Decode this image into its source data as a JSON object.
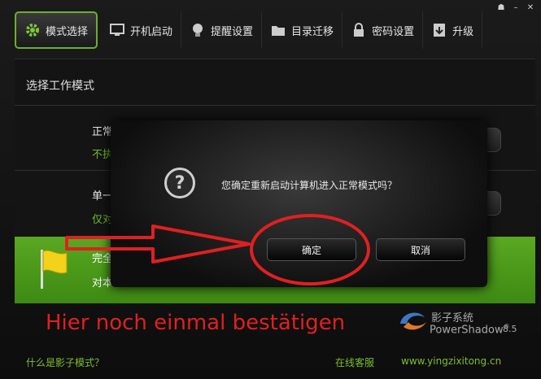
{
  "window_controls": [
    "☗",
    "–",
    "✕"
  ],
  "tabs": [
    {
      "label": "模式选择",
      "icon": "gear-icon",
      "active": true
    },
    {
      "label": "开机启动",
      "icon": "monitor-icon"
    },
    {
      "label": "提醒设置",
      "icon": "lightbulb-icon"
    },
    {
      "label": "目录迁移",
      "icon": "folder-icon"
    },
    {
      "label": "密码设置",
      "icon": "lock-icon"
    },
    {
      "label": "升级",
      "icon": "upgrade-icon"
    }
  ],
  "panel": {
    "title": "选择工作模式",
    "options": [
      {
        "title": "正常模",
        "subtitle": "不执"
      },
      {
        "title": "单一",
        "subtitle": "仅对"
      },
      {
        "title": "完全",
        "subtitle": "对本"
      }
    ]
  },
  "dialog": {
    "message": "您确定重新启动计算机进入正常模式吗？",
    "confirm_label": "确定",
    "cancel_label": "取消"
  },
  "annotation": {
    "text": "Hier noch einmal bestätigen",
    "color": "#e02020"
  },
  "logo": {
    "name": "影子系统",
    "product": "PowerShadow",
    "registered": "®",
    "version": "8.5"
  },
  "footer": {
    "help_link": "什么是影子模式？",
    "support_link": "在线客服",
    "website": "www.yingzixitong.cn"
  },
  "colors": {
    "accent": "#6cae2d",
    "annotation": "#e02020"
  }
}
